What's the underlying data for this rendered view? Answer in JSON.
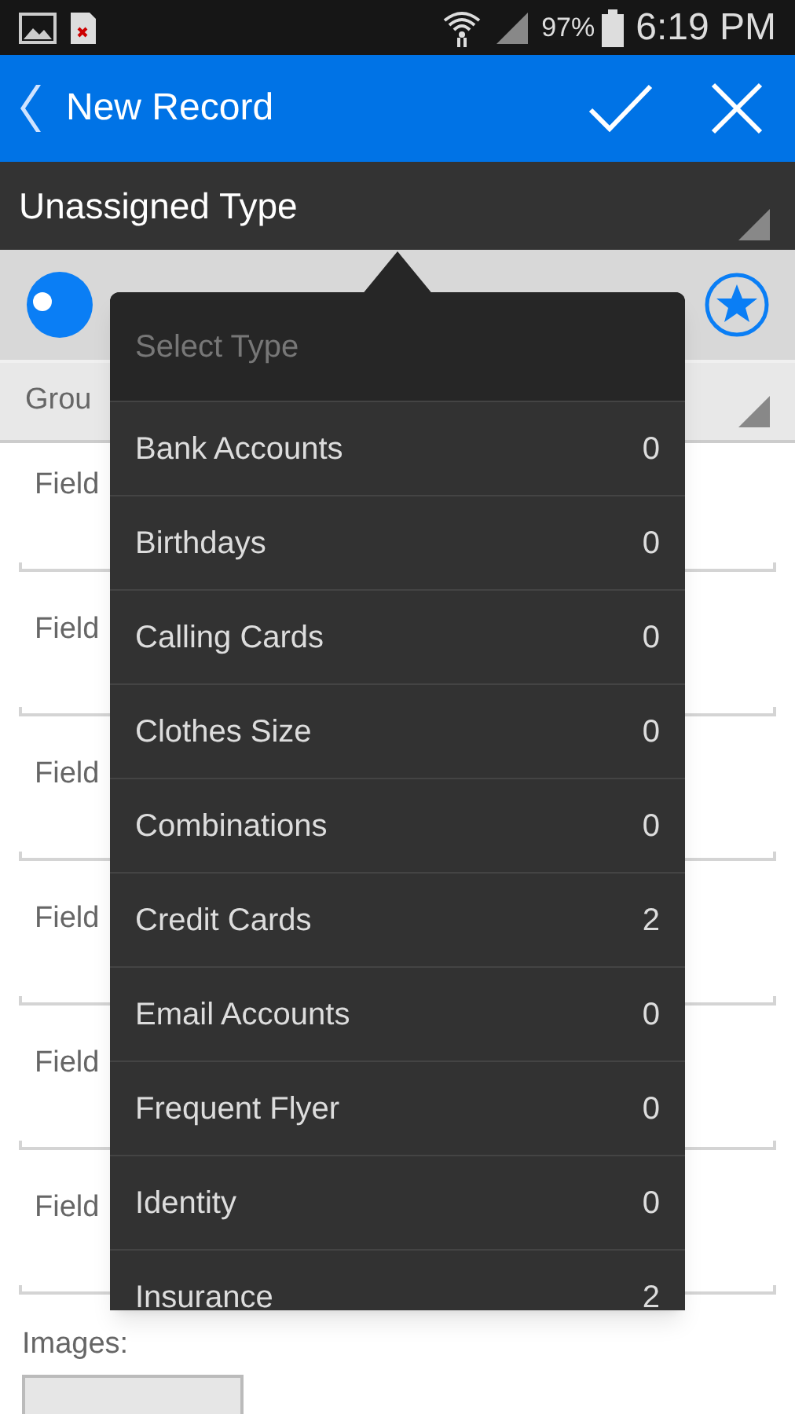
{
  "status_bar": {
    "battery": "97%",
    "time": "6:19 PM"
  },
  "app_bar": {
    "title": "New Record"
  },
  "type_selector": {
    "value": "Unassigned Type"
  },
  "group_row": {
    "label": "Grou"
  },
  "fields": [
    {
      "label": "Field"
    },
    {
      "label": "Field"
    },
    {
      "label": "Field"
    },
    {
      "label": "Field"
    },
    {
      "label": "Field"
    },
    {
      "label": "Field"
    }
  ],
  "images": {
    "label": "Images:"
  },
  "type_menu": {
    "header": "Select Type",
    "items": [
      {
        "label": "Bank Accounts",
        "count": "0"
      },
      {
        "label": "Birthdays",
        "count": "0"
      },
      {
        "label": "Calling Cards",
        "count": "0"
      },
      {
        "label": "Clothes Size",
        "count": "0"
      },
      {
        "label": "Combinations",
        "count": "0"
      },
      {
        "label": "Credit Cards",
        "count": "2"
      },
      {
        "label": "Email Accounts",
        "count": "0"
      },
      {
        "label": "Frequent Flyer",
        "count": "0"
      },
      {
        "label": "Identity",
        "count": "0"
      },
      {
        "label": "Insurance",
        "count": "2"
      }
    ]
  }
}
